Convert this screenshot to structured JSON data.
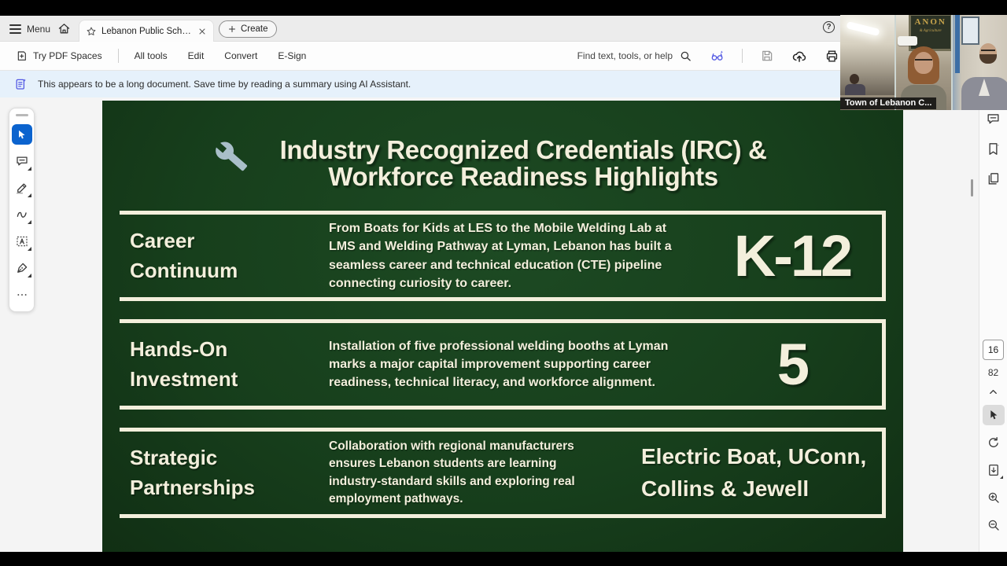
{
  "chrome": {
    "menu_label": "Menu",
    "tab_title": "Lebanon Public Schools ...",
    "create_label": "Create",
    "help_label": "?",
    "try_pdf_spaces": "Try PDF Spaces",
    "nav_items": [
      "All tools",
      "Edit",
      "Convert",
      "E-Sign"
    ],
    "find_placeholder": "Find text, tools, or help",
    "banner_text": "This appears to be a long document. Save time by reading a summary using AI Assistant.",
    "page_current": "16",
    "page_total": "82"
  },
  "video": {
    "caption": "Town of Lebanon C...",
    "sign_line1": "ANON",
    "sign_line2": "& Agriculture"
  },
  "slide": {
    "title_line1": "Industry Recognized Credentials (IRC) &",
    "title_line2": "Workforce Readiness Highlights",
    "rows": [
      {
        "label": "Career Continuum",
        "body": "From Boats for Kids at LES to the Mobile Welding Lab at LMS and Welding Pathway at Lyman, Lebanon has built a seamless career and technical education (CTE) pipeline connecting curiosity to career.",
        "stat": "K-12"
      },
      {
        "label": "Hands-On Investment",
        "body": "Installation of five professional welding booths at Lyman marks a major capital improvement supporting career readiness, technical literacy, and workforce alignment.",
        "stat": "5"
      },
      {
        "label": "Strategic Partnerships",
        "body": "Collaboration with regional manufacturers ensures Lebanon students are learning industry-standard skills and exploring real employment pathways.",
        "stat": "Electric Boat, UConn, Collins & Jewell"
      }
    ],
    "colors": {
      "background": "#173F1C",
      "text": "#F3EFDC"
    }
  }
}
